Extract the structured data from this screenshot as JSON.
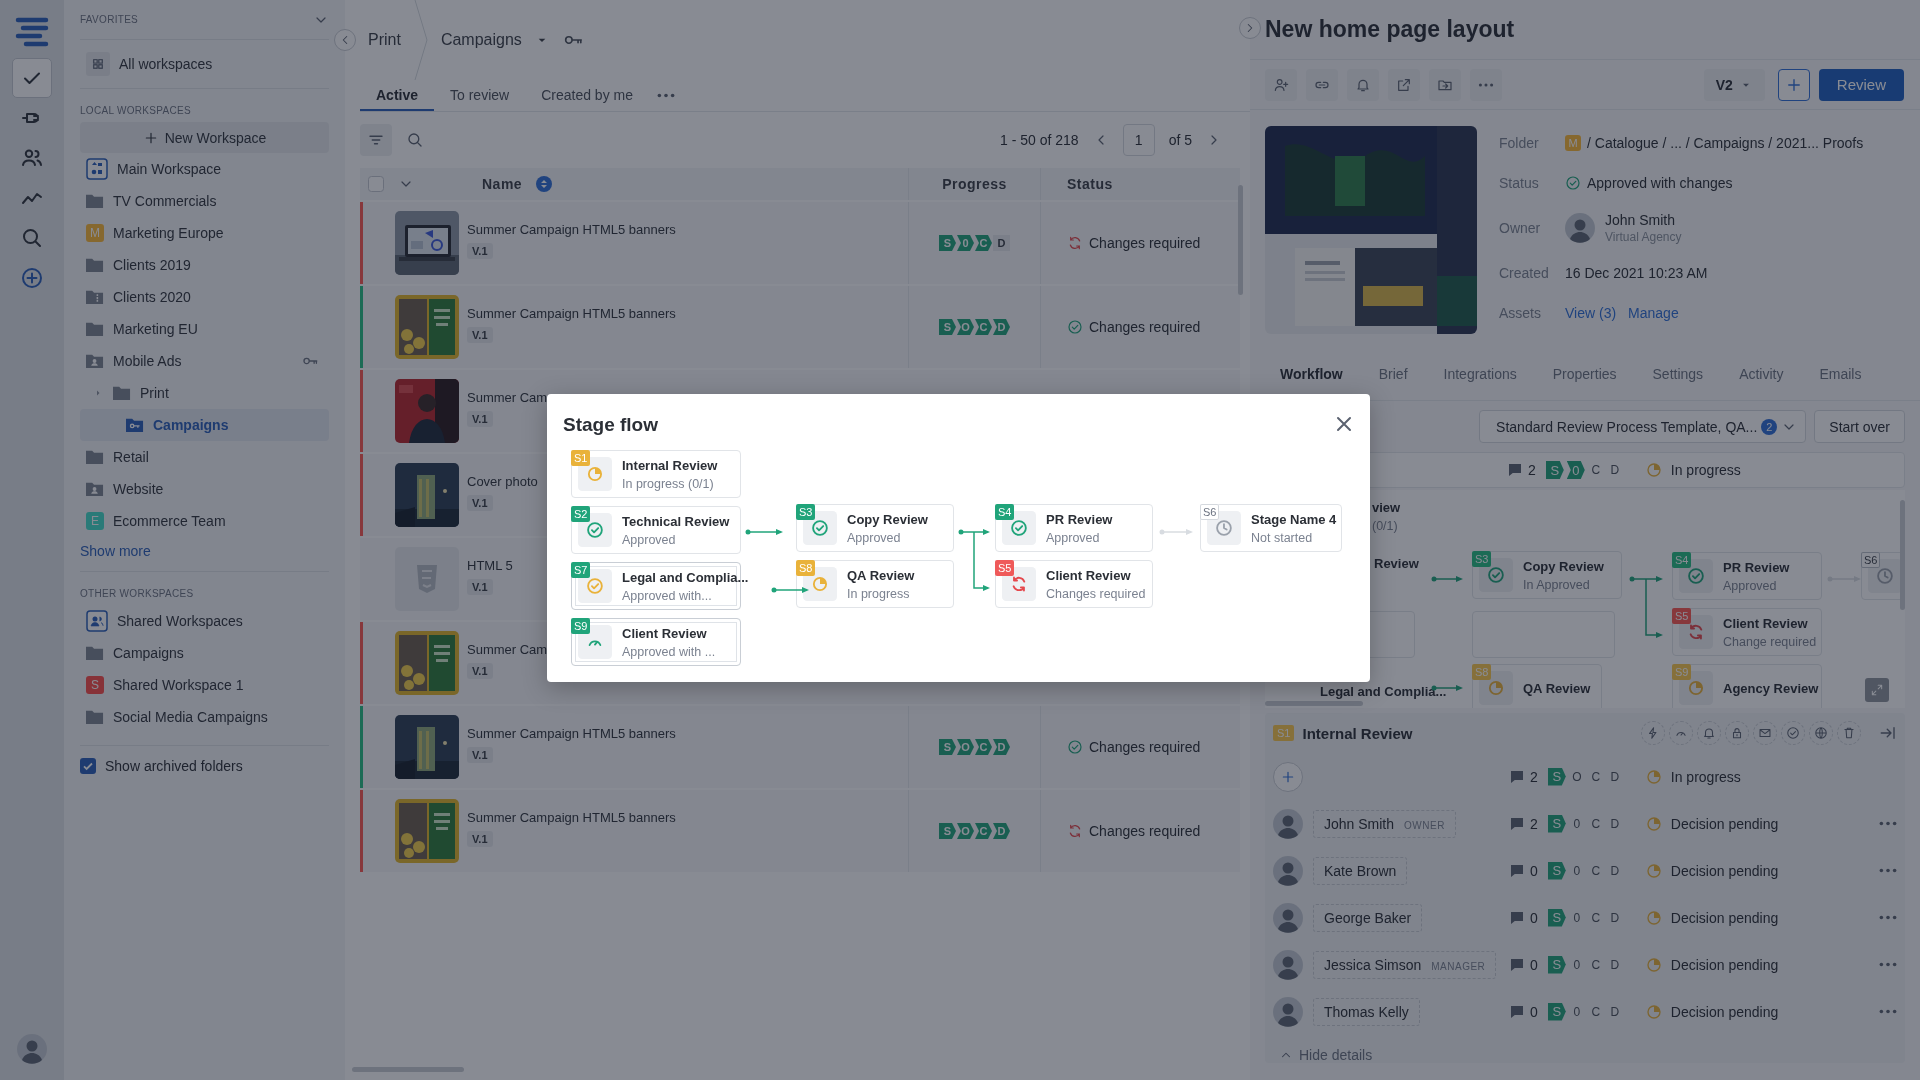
{
  "rail": {
    "items": [
      {
        "kind": "check",
        "selected": true
      },
      {
        "kind": "plug",
        "selected": false
      },
      {
        "kind": "people",
        "selected": false
      },
      {
        "kind": "chart",
        "selected": false
      },
      {
        "kind": "search",
        "selected": false
      },
      {
        "kind": "add",
        "selected": false
      }
    ]
  },
  "sidebar": {
    "favorites_heading": "FAVORITES",
    "favorites": [
      {
        "kind": "grid",
        "label": "All workspaces"
      }
    ],
    "local_heading": "LOCAL WORKSPACES",
    "new_workspace": "New Workspace",
    "local": [
      {
        "kind": "workspace",
        "label": "Main Workspace",
        "selected": false,
        "key": false
      },
      {
        "kind": "folder",
        "label": "TV Commercials",
        "selected": false,
        "key": false
      },
      {
        "kind": "letter",
        "letter": "M",
        "color": "#86682f",
        "label": "Marketing Europe",
        "selected": false,
        "key": false
      },
      {
        "kind": "folder",
        "label": "Clients 2019",
        "selected": false,
        "key": false
      },
      {
        "kind": "folder-zip",
        "label": "Clients 2020",
        "selected": false,
        "key": false
      },
      {
        "kind": "folder",
        "label": "Marketing EU",
        "selected": false,
        "key": false
      },
      {
        "kind": "folder-user",
        "label": "Mobile Ads",
        "selected": false,
        "key": true
      },
      {
        "kind": "folder",
        "label": "Print",
        "selected": false,
        "key": false,
        "children": [
          {
            "kind": "folder-key",
            "label": "Campaigns",
            "selected": true,
            "key": false
          }
        ]
      },
      {
        "kind": "folder",
        "label": "Retail",
        "selected": false,
        "key": false
      },
      {
        "kind": "folder-user",
        "label": "Website",
        "selected": false,
        "key": false
      },
      {
        "kind": "letter",
        "letter": "E",
        "color": "#2a7a78",
        "label": "Ecommerce Team",
        "selected": false,
        "key": false
      }
    ],
    "show_more": "Show more",
    "other_heading": "OTHER WORKSPACES",
    "other": [
      {
        "kind": "people",
        "label": "Shared Workspaces",
        "selected": false,
        "key": false
      },
      {
        "kind": "folder",
        "label": "Campaigns",
        "selected": false,
        "key": false
      },
      {
        "kind": "letter",
        "letter": "S",
        "color": "#873238",
        "label": "Shared Workspace 1",
        "selected": false,
        "key": false
      },
      {
        "kind": "folder",
        "label": "Social Media Campaigns",
        "selected": false,
        "key": false
      }
    ],
    "archived": {
      "label": "Show archived folders",
      "checked": true
    }
  },
  "main": {
    "breadcrumb": [
      {
        "label": "Print"
      },
      {
        "label": "Campaigns"
      }
    ],
    "tabs": [
      {
        "label": "Active",
        "selected": true
      },
      {
        "label": "To review",
        "selected": false
      },
      {
        "label": "Created by me",
        "selected": false
      }
    ],
    "pager": {
      "range": "1 - 50 of 218",
      "page": "1",
      "total": "of 5"
    },
    "table": {
      "select_all": {
        "checked": false
      },
      "columns": [
        "Name",
        "Progress",
        "Status"
      ],
      "rows": [
        {
          "color": "#87383c",
          "thumb": {
            "kind": "picture"
          },
          "name": "Summer Campaign HTML5 banners",
          "version": "V.1",
          "progress": [
            {
              "letter": "S",
              "done": true
            },
            {
              "letter": "0",
              "done": true
            },
            {
              "letter": "C",
              "done": true
            },
            {
              "letter": "D",
              "done": false
            }
          ],
          "status": {
            "kind": "changes",
            "label": "Changes required"
          }
        },
        {
          "color": "#1c6b55",
          "thumb": {
            "kind": "picture"
          },
          "name": "Summer Campaign HTML5 banners",
          "version": "V.1",
          "progress": [
            {
              "letter": "S",
              "done": true
            },
            {
              "letter": "O",
              "done": true
            },
            {
              "letter": "C",
              "done": true
            },
            {
              "letter": "D",
              "done": true
            }
          ],
          "status": {
            "kind": "approved",
            "label": "Changes required"
          }
        },
        {
          "color": "#87383c",
          "thumb": {
            "kind": "picture"
          },
          "name": "Summer Cam",
          "version": "V.1"
        },
        {
          "color": "#87383c",
          "thumb": {
            "kind": "picture"
          },
          "name": "Cover photo",
          "version": "V.1"
        },
        {
          "thumb": {
            "kind": "file"
          },
          "name": "HTML 5",
          "version": "V.1"
        },
        {
          "color": "#87383c",
          "thumb": {
            "kind": "picture"
          },
          "name": "Summer Cam",
          "version": "V.1"
        },
        {
          "color": "#1c6b55",
          "thumb": {
            "kind": "picture"
          },
          "name": "Summer Campaign HTML5 banners",
          "version": "V.1",
          "progress": [
            {
              "letter": "S",
              "done": true
            },
            {
              "letter": "O",
              "done": true
            },
            {
              "letter": "C",
              "done": true
            },
            {
              "letter": "D",
              "done": true
            }
          ],
          "status": {
            "kind": "approved",
            "label": "Changes required"
          }
        },
        {
          "color": "#87383c",
          "thumb": {
            "kind": "picture"
          },
          "name": "Summer Campaign HTML5 banners",
          "version": "V.1",
          "progress": [
            {
              "letter": "S",
              "done": true
            },
            {
              "letter": "O",
              "done": true
            },
            {
              "letter": "C",
              "done": true
            },
            {
              "letter": "D",
              "done": true
            }
          ],
          "status": {
            "kind": "changes",
            "label": "Changes required"
          }
        }
      ]
    }
  },
  "detail": {
    "title": "New home page layout",
    "version": "V2",
    "review": "Review",
    "info": [
      {
        "kind": "folder",
        "label": "Folder",
        "letter": "M",
        "color": "#86682f",
        "value": "/ Catalogue / ... / Campaigns / 2021... Proofs"
      },
      {
        "kind": "status",
        "label": "Status",
        "value": "Approved with changes"
      },
      {
        "kind": "owner",
        "label": "Owner",
        "value": "John Smith",
        "sub": "Virtual Agency"
      },
      {
        "kind": "text",
        "label": "Created",
        "value": "16 Dec 2021 10:23  AM"
      },
      {
        "kind": "links",
        "label": "Assets",
        "links": [
          "View (3)",
          "Manage"
        ]
      }
    ],
    "tabs": [
      {
        "label": "Workflow",
        "selected": true
      },
      {
        "label": "Brief",
        "selected": false
      },
      {
        "label": "Integrations",
        "selected": false
      },
      {
        "label": "Properties",
        "selected": false
      },
      {
        "label": "Settings",
        "selected": false
      },
      {
        "label": "Activity",
        "selected": false
      },
      {
        "label": "Emails",
        "selected": false
      }
    ],
    "template": {
      "name": "Standard Review Process Template, QA...",
      "count": "2"
    },
    "start_over": "Start over",
    "summary": {
      "comments": "2",
      "progress": [
        {
          "letter": "S",
          "done": true
        },
        {
          "letter": "0",
          "done": true
        },
        {
          "letter": "C",
          "done": false
        },
        {
          "letter": "D",
          "done": false
        }
      ],
      "status": "In progress"
    },
    "canvas": {
      "nodes": [
        {
          "kind": "cut",
          "name": "view",
          "status": "(0/1)"
        },
        {
          "kind": "cut",
          "name": "Review"
        },
        {
          "kind": "blank"
        },
        {
          "kind": "cut",
          "name": "Legal and Complia..."
        },
        {
          "kind": "approved",
          "badge": "S3",
          "color": "#1c6b55",
          "name": "Copy Review",
          "status": "In Approved"
        },
        {
          "kind": "blank"
        },
        {
          "kind": "progress",
          "badge": "S8",
          "color": "#86703a",
          "name": "QA Review"
        },
        {
          "kind": "approved",
          "badge": "S4",
          "color": "#1c6b55",
          "name": "PR Review",
          "status": "Approved"
        },
        {
          "kind": "changes",
          "badge": "S5",
          "color": "#87383c",
          "name": "Client Review",
          "status": "Change required"
        },
        {
          "kind": "progress",
          "badge": "S9",
          "color": "#86703a",
          "name": "Agency Review"
        },
        {
          "kind": "notstarted",
          "badge": "S6",
          "color": "#888c93"
        }
      ]
    },
    "stage": {
      "badge": "S1",
      "color": "#86703a",
      "title": "Internal Review",
      "summary": {
        "comments": "2",
        "progress": [
          {
            "letter": "S",
            "done": true
          },
          {
            "letter": "O",
            "done": false
          },
          {
            "letter": "C",
            "done": false
          },
          {
            "letter": "D",
            "done": false
          }
        ],
        "status": "In progress"
      },
      "people": [
        {
          "name": "John Smith",
          "role": "OWNER",
          "comments": "2",
          "progress": [
            {
              "letter": "S",
              "done": true
            },
            {
              "letter": "0",
              "done": false
            },
            {
              "letter": "C",
              "done": false
            },
            {
              "letter": "D",
              "done": false
            }
          ],
          "status": "Decision pending"
        },
        {
          "name": "Kate Brown",
          "comments": "0",
          "progress": [
            {
              "letter": "S",
              "done": true
            },
            {
              "letter": "0",
              "done": false
            },
            {
              "letter": "C",
              "done": false
            },
            {
              "letter": "D",
              "done": false
            }
          ],
          "status": "Decision pending"
        },
        {
          "name": "George Baker",
          "comments": "0",
          "progress": [
            {
              "letter": "S",
              "done": true
            },
            {
              "letter": "0",
              "done": false
            },
            {
              "letter": "C",
              "done": false
            },
            {
              "letter": "D",
              "done": false
            }
          ],
          "status": "Decision pending"
        },
        {
          "name": "Jessica Simson",
          "role": "MANAGER",
          "comments": "0",
          "progress": [
            {
              "letter": "S",
              "done": true
            },
            {
              "letter": "0",
              "done": false
            },
            {
              "letter": "C",
              "done": false
            },
            {
              "letter": "D",
              "done": false
            }
          ],
          "status": "Decision pending"
        },
        {
          "name": "Thomas Kelly",
          "comments": "0",
          "progress": [
            {
              "letter": "S",
              "done": true
            },
            {
              "letter": "0",
              "done": false
            },
            {
              "letter": "C",
              "done": false
            },
            {
              "letter": "D",
              "done": false
            }
          ],
          "status": "Decision pending"
        }
      ],
      "hide": "Hide details"
    }
  },
  "stage_flow": {
    "title": "Stage flow",
    "columns": [
      {
        "stages": [
          {
            "badge": "S1",
            "color": "#e9b23a",
            "name": "Internal Review",
            "status": "In progress (0/1)",
            "kind": "progress",
            "stacked": false
          },
          {
            "badge": "S2",
            "color": "#20a47a",
            "name": "Technical Review",
            "status": "Approved",
            "kind": "approved",
            "stacked": false
          },
          {
            "badge": "S7",
            "color": "#20a47a",
            "name": "Legal and Complia...",
            "status": "Approved with...",
            "kind": "warn",
            "stacked": true
          },
          {
            "badge": "S9",
            "color": "#20a47a",
            "name": "Client Review",
            "status": "Approved with ...",
            "kind": "gauge",
            "stacked": true
          }
        ]
      },
      {
        "stages": [
          {
            "badge": "S3",
            "color": "#20a47a",
            "name": "Copy Review",
            "status": "Approved",
            "kind": "approved",
            "stacked": false
          },
          {
            "badge": "S8",
            "color": "#e9b23a",
            "name": "QA Review",
            "status": "In progress",
            "kind": "progress",
            "stacked": false
          }
        ]
      },
      {
        "stages": [
          {
            "badge": "S4",
            "color": "#20a47a",
            "name": "PR Review",
            "status": "Approved",
            "kind": "approved",
            "stacked": false
          },
          {
            "badge": "S5",
            "color": "#ef5a5a",
            "name": "Client Review",
            "status": "Changes required",
            "kind": "changes",
            "stacked": false
          }
        ]
      },
      {
        "stages": [
          {
            "badge": "S6",
            "color": "#ffffff",
            "name": "Stage Name 4",
            "status": "Not started",
            "kind": "notstarted",
            "stacked": false
          }
        ]
      }
    ]
  }
}
